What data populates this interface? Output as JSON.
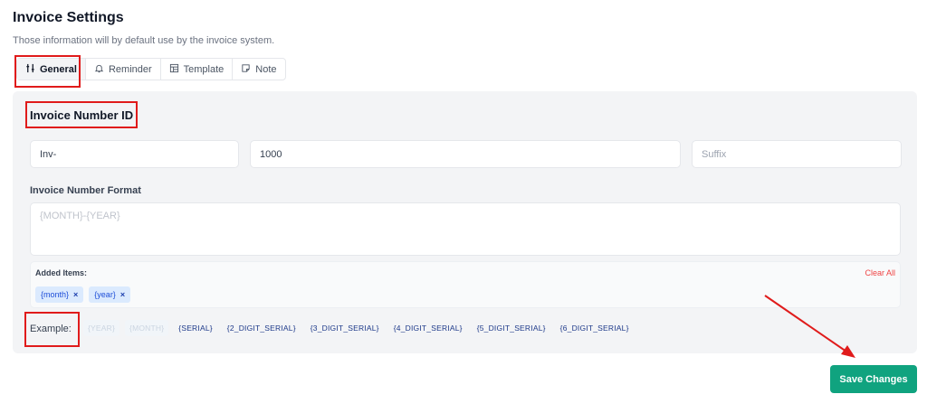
{
  "page": {
    "title": "Invoice Settings",
    "subtitle": "Those information will by default use by the invoice system."
  },
  "tabs": [
    {
      "label": "General",
      "icon": "sliders-icon",
      "active": true
    },
    {
      "label": "Reminder",
      "icon": "bell-icon",
      "active": false
    },
    {
      "label": "Template",
      "icon": "template-icon",
      "active": false
    },
    {
      "label": "Note",
      "icon": "note-icon",
      "active": false
    }
  ],
  "invoice_number": {
    "title": "Invoice Number ID",
    "prefix_value": "Inv-",
    "number_value": "1000",
    "suffix_placeholder": "Suffix"
  },
  "format": {
    "label": "Invoice Number Format",
    "placeholder": "{MONTH}-{YEAR}"
  },
  "added_items": {
    "label": "Added Items:",
    "clear_label": "Clear All",
    "chips": [
      "{month}",
      "{year}"
    ],
    "remove_glyph": "×"
  },
  "example": {
    "label": "Example:",
    "tokens": [
      {
        "text": "{YEAR}",
        "disabled": true
      },
      {
        "text": "{MONTH}",
        "disabled": true
      },
      {
        "text": "{SERIAL}",
        "disabled": false
      },
      {
        "text": "{2_DIGIT_SERIAL}",
        "disabled": false
      },
      {
        "text": "{3_DIGIT_SERIAL}",
        "disabled": false
      },
      {
        "text": "{4_DIGIT_SERIAL}",
        "disabled": false
      },
      {
        "text": "{5_DIGIT_SERIAL}",
        "disabled": false
      },
      {
        "text": "{6_DIGIT_SERIAL}",
        "disabled": false
      }
    ]
  },
  "actions": {
    "save_label": "Save Changes"
  },
  "colors": {
    "accent": "#10a37f",
    "highlight": "#e01b1b",
    "chip_bg": "#dbeafe",
    "danger": "#ef4444"
  }
}
